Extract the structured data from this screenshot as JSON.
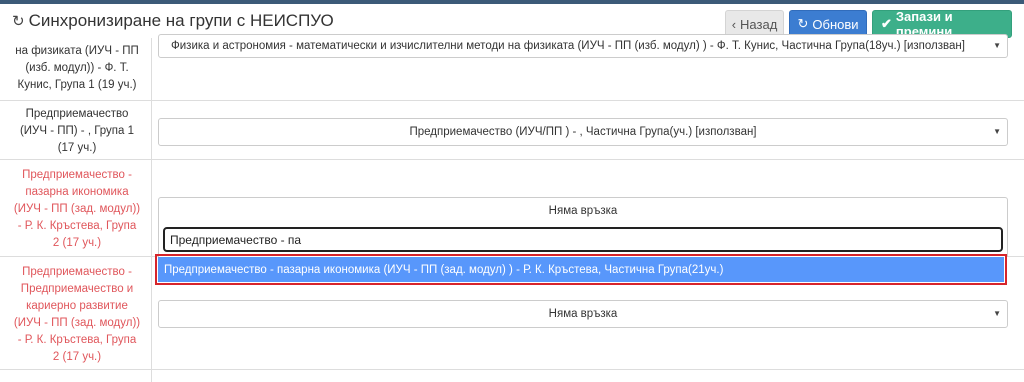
{
  "header": {
    "title": "Синхронизиране на групи с НЕИСПУО",
    "back_label": "Назад",
    "refresh_label": "Обнови",
    "save_label": "Запази и премини"
  },
  "rows": [
    {
      "label_lines": [
        "на физиката (ИУЧ - ПП",
        "(изб. модул)) - Ф. Т.",
        "Кунис, Група 1 (19 уч.)"
      ],
      "selected": "Физика и астрономия - математически и изчислителни методи на физиката (ИУЧ - ПП (изб. модул) ) - Ф. Т. Кунис, Частична Група(18уч.) [използван]"
    },
    {
      "label_lines": [
        "Предприемачество",
        "(ИУЧ - ПП) - , Група 1",
        "(17 уч.)"
      ],
      "selected": "Предприемачество (ИУЧ/ПП ) - , Частична Група(уч.) [използван]"
    },
    {
      "label_lines": [
        "Предприемачество -",
        "пазарна икономика",
        "(ИУЧ - ПП (зад. модул))",
        "- Р. К. Кръстева, Група",
        "2 (17 уч.)"
      ],
      "selected": "Няма връзка",
      "search_value": "Предприемачество - па",
      "highlighted_option": "Предприемачество - пазарна икономика (ИУЧ - ПП (зад. модул) ) - Р. К. Кръстева, Частична Група(21уч.)"
    },
    {
      "label_lines": [
        "Предприемачество -",
        "Предприемачество и",
        "кариерно развитие",
        "(ИУЧ - ПП (зад. модул))",
        "- Р. К. Кръстева, Група",
        "2 (17 уч.)"
      ],
      "selected": "Няма връзка"
    }
  ],
  "icons": {
    "title": "refresh-icon",
    "back": "chevron-left-icon",
    "refresh": "refresh-icon",
    "save": "check-icon",
    "select_arrow": "caret-down-icon"
  }
}
